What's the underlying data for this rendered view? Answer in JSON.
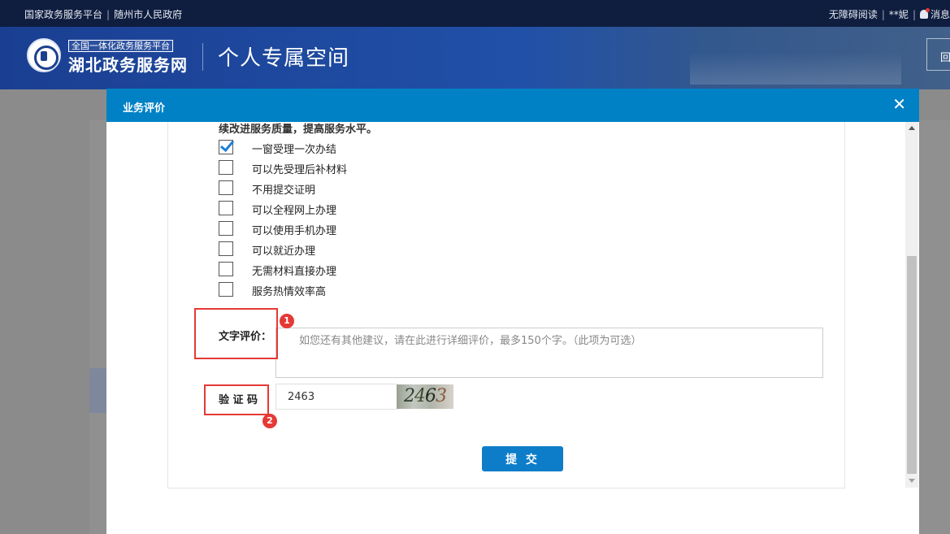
{
  "topbar": {
    "left_links": [
      "国家政务服务平台",
      "随州市人民政府"
    ],
    "right_links": [
      "无障碍阅读",
      "**妮",
      "消息"
    ]
  },
  "header": {
    "logo_subtitle": "全国一体化政务服务平台",
    "logo_title": "湖北政务服务网",
    "page_title": "个人专属空间",
    "right_button": "回"
  },
  "modal": {
    "title": "业务评价",
    "close_icon": "close-icon",
    "intro_text": "续改进服务质量，提高服务水平。",
    "options": [
      {
        "label": "一窗受理一次办结",
        "checked": true
      },
      {
        "label": "可以先受理后补材料",
        "checked": false
      },
      {
        "label": "不用提交证明",
        "checked": false
      },
      {
        "label": "可以全程网上办理",
        "checked": false
      },
      {
        "label": "可以使用手机办理",
        "checked": false
      },
      {
        "label": "可以就近办理",
        "checked": false
      },
      {
        "label": "无需材料直接办理",
        "checked": false
      },
      {
        "label": "服务热情效率高",
        "checked": false
      }
    ],
    "comment_label": "文字评价：",
    "comment_placeholder": "如您还有其他建议，请在此进行详细评价，最多150个字。（此项为可选）",
    "captcha_label": "验 证 码",
    "captcha_value": "2463",
    "captcha_image_text": "2463",
    "submit_label": "提 交"
  },
  "annotations": {
    "badge_1": "1",
    "badge_2": "2",
    "color": "#e53935"
  },
  "colors": {
    "topbar": "#0f1d3f",
    "header": "#1a3f92",
    "modal_header": "#0081c6",
    "submit": "#0d7dc9"
  }
}
